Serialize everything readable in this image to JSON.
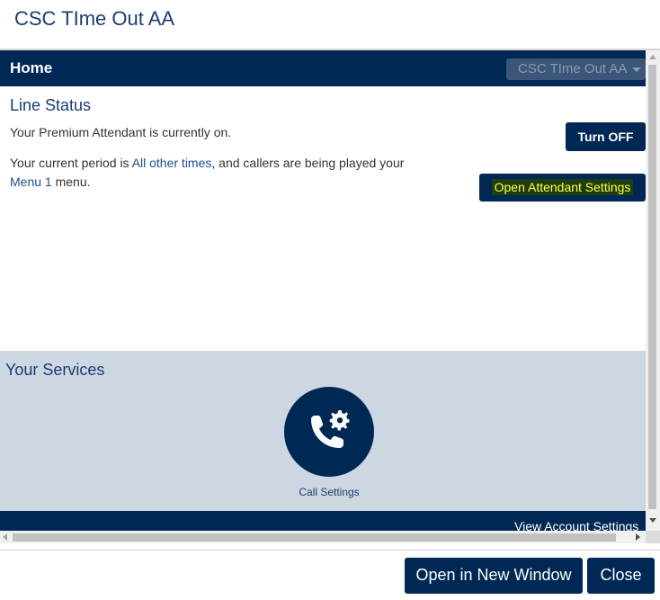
{
  "dialog": {
    "title": "CSC TIme Out AA"
  },
  "header": {
    "home_label": "Home",
    "account_selected": "CSC TIme Out AA"
  },
  "line_status": {
    "title": "Line Status",
    "status_text": "Your Premium Attendant is currently on.",
    "period_prefix": "Your current period is ",
    "period_link": "All other times",
    "period_middle": ", and callers are being played your ",
    "menu_link": "Menu 1",
    "period_suffix": " menu.",
    "turn_off_label": "Turn OFF",
    "open_settings_label": "Open Attendant Settings"
  },
  "services": {
    "title": "Your Services",
    "call_settings_label": "Call Settings"
  },
  "footer": {
    "view_account_label": "View Account Settings"
  },
  "actions": {
    "open_window_label": "Open in New Window",
    "close_label": "Close"
  },
  "icons": {
    "call_settings": "phone-gear-icon"
  },
  "colors": {
    "navy": "#002855",
    "services_bg": "#cdd7e2",
    "highlight_bg": "#1e3d12",
    "highlight_text": "#ffff40"
  }
}
